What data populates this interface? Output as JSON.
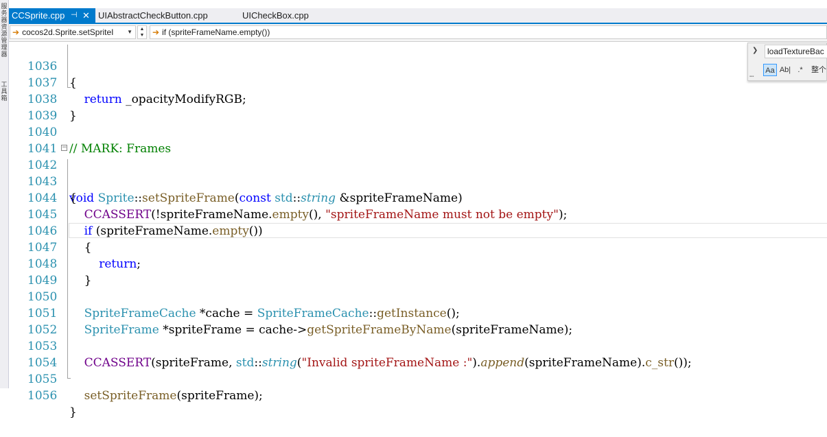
{
  "left_strip": {
    "labels": [
      "服务器资源管理器",
      "工具箱"
    ]
  },
  "tabs": [
    {
      "label": "CCSprite.cpp",
      "active": true,
      "pin_icon": "pin-icon",
      "close_icon": "close-icon"
    },
    {
      "label": "UIAbstractCheckButton.cpp",
      "active": false
    },
    {
      "label": "UICheckBox.cpp",
      "active": false
    }
  ],
  "navbar": {
    "scope": "cocos2d.Sprite.setSpriteI",
    "member": "if (spriteFrameName.empty())"
  },
  "find": {
    "query": "loadTextureBac",
    "options": [
      "Aa",
      "Ab|",
      ".*",
      "整个"
    ]
  },
  "code_lines": [
    {
      "num": "1036",
      "text": "{"
    },
    {
      "num": "1037",
      "text": "    return _opacityModifyRGB;"
    },
    {
      "num": "1038",
      "text": "}"
    },
    {
      "num": "1039",
      "text": ""
    },
    {
      "num": "1040",
      "text": "// MARK: Frames"
    },
    {
      "num": "1041",
      "text": ""
    },
    {
      "num": "1042",
      "text": "void Sprite::setSpriteFrame(const std::string &spriteFrameName)"
    },
    {
      "num": "1043",
      "text": "{"
    },
    {
      "num": "1044",
      "text": "    CCASSERT(!spriteFrameName.empty(), \"spriteFrameName must not be empty\");"
    },
    {
      "num": "1045",
      "text": "    if (spriteFrameName.empty())"
    },
    {
      "num": "1046",
      "text": "    {"
    },
    {
      "num": "1047",
      "text": "        return;"
    },
    {
      "num": "1048",
      "text": "    }"
    },
    {
      "num": "1049",
      "text": ""
    },
    {
      "num": "1050",
      "text": "    SpriteFrameCache *cache = SpriteFrameCache::getInstance();"
    },
    {
      "num": "1051",
      "text": "    SpriteFrame *spriteFrame = cache->getSpriteFrameByName(spriteFrameName);"
    },
    {
      "num": "1052",
      "text": ""
    },
    {
      "num": "1053",
      "text": "    CCASSERT(spriteFrame, std::string(\"Invalid spriteFrameName :\").append(spriteFrameName).c_str());"
    },
    {
      "num": "1054",
      "text": ""
    },
    {
      "num": "1055",
      "text": "    setSpriteFrame(spriteFrame);"
    },
    {
      "num": "1056",
      "text": "}"
    }
  ],
  "colors": {
    "accent": "#007acc",
    "keyword": "#0000ff",
    "type": "#2b91af",
    "function": "#795e26",
    "macro": "#6f008a",
    "string": "#a31515",
    "comment": "#008000",
    "line_number": "#2b91af"
  }
}
